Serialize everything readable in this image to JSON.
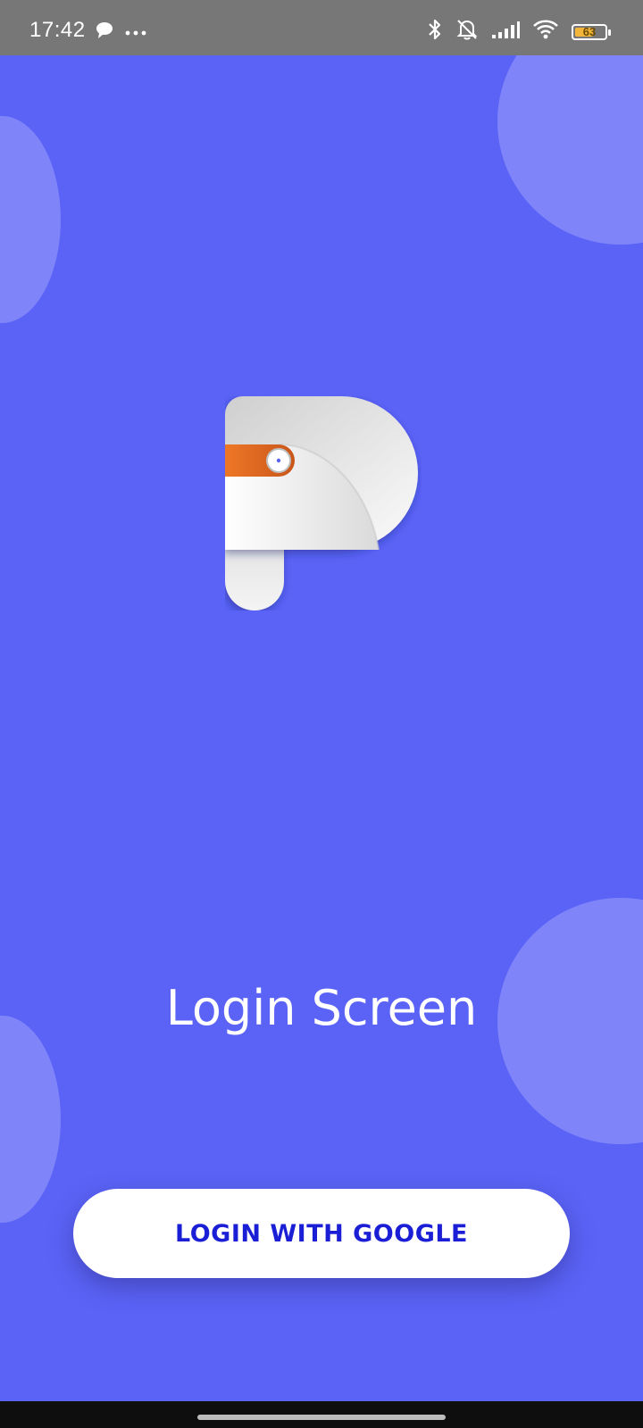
{
  "status_bar": {
    "time": "17:42",
    "battery_level": "63",
    "battery_percent": 63,
    "icons": [
      "chat-bubble-icon",
      "more-dots-icon",
      "bluetooth-icon",
      "bell-off-icon",
      "signal-icon",
      "wifi-icon",
      "battery-icon"
    ]
  },
  "app": {
    "logo": "app-logo-p",
    "title": "Login Screen",
    "login_button_label": "LOGIN WITH GOOGLE"
  },
  "colors": {
    "background": "#5b63f7",
    "status_bar": "#777777",
    "button_text": "#1a1fd6",
    "logo_accent": "#e8701f",
    "battery_fill": "#f4b63a"
  }
}
